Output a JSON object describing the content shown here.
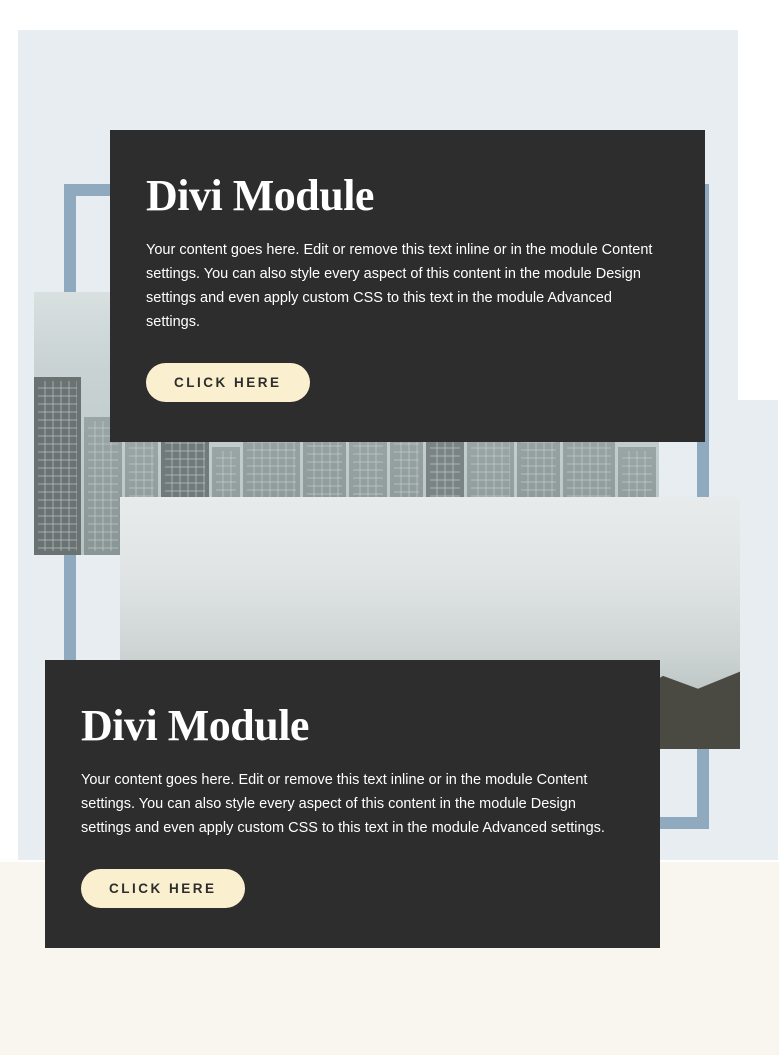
{
  "cards": [
    {
      "title": "Divi Module",
      "body": "Your content goes here. Edit or remove this text inline or in the module Content settings. You can also style every aspect of this content in the module Design settings and even apply custom CSS to this text in the module Advanced settings.",
      "button_label": "CLICK HERE"
    },
    {
      "title": "Divi Module",
      "body": "Your content goes here. Edit or remove this text inline or in the module Content settings. You can also style every aspect of this content in the module Design settings and even apply custom CSS to this text in the module Advanced settings.",
      "button_label": "CLICK HERE"
    }
  ]
}
